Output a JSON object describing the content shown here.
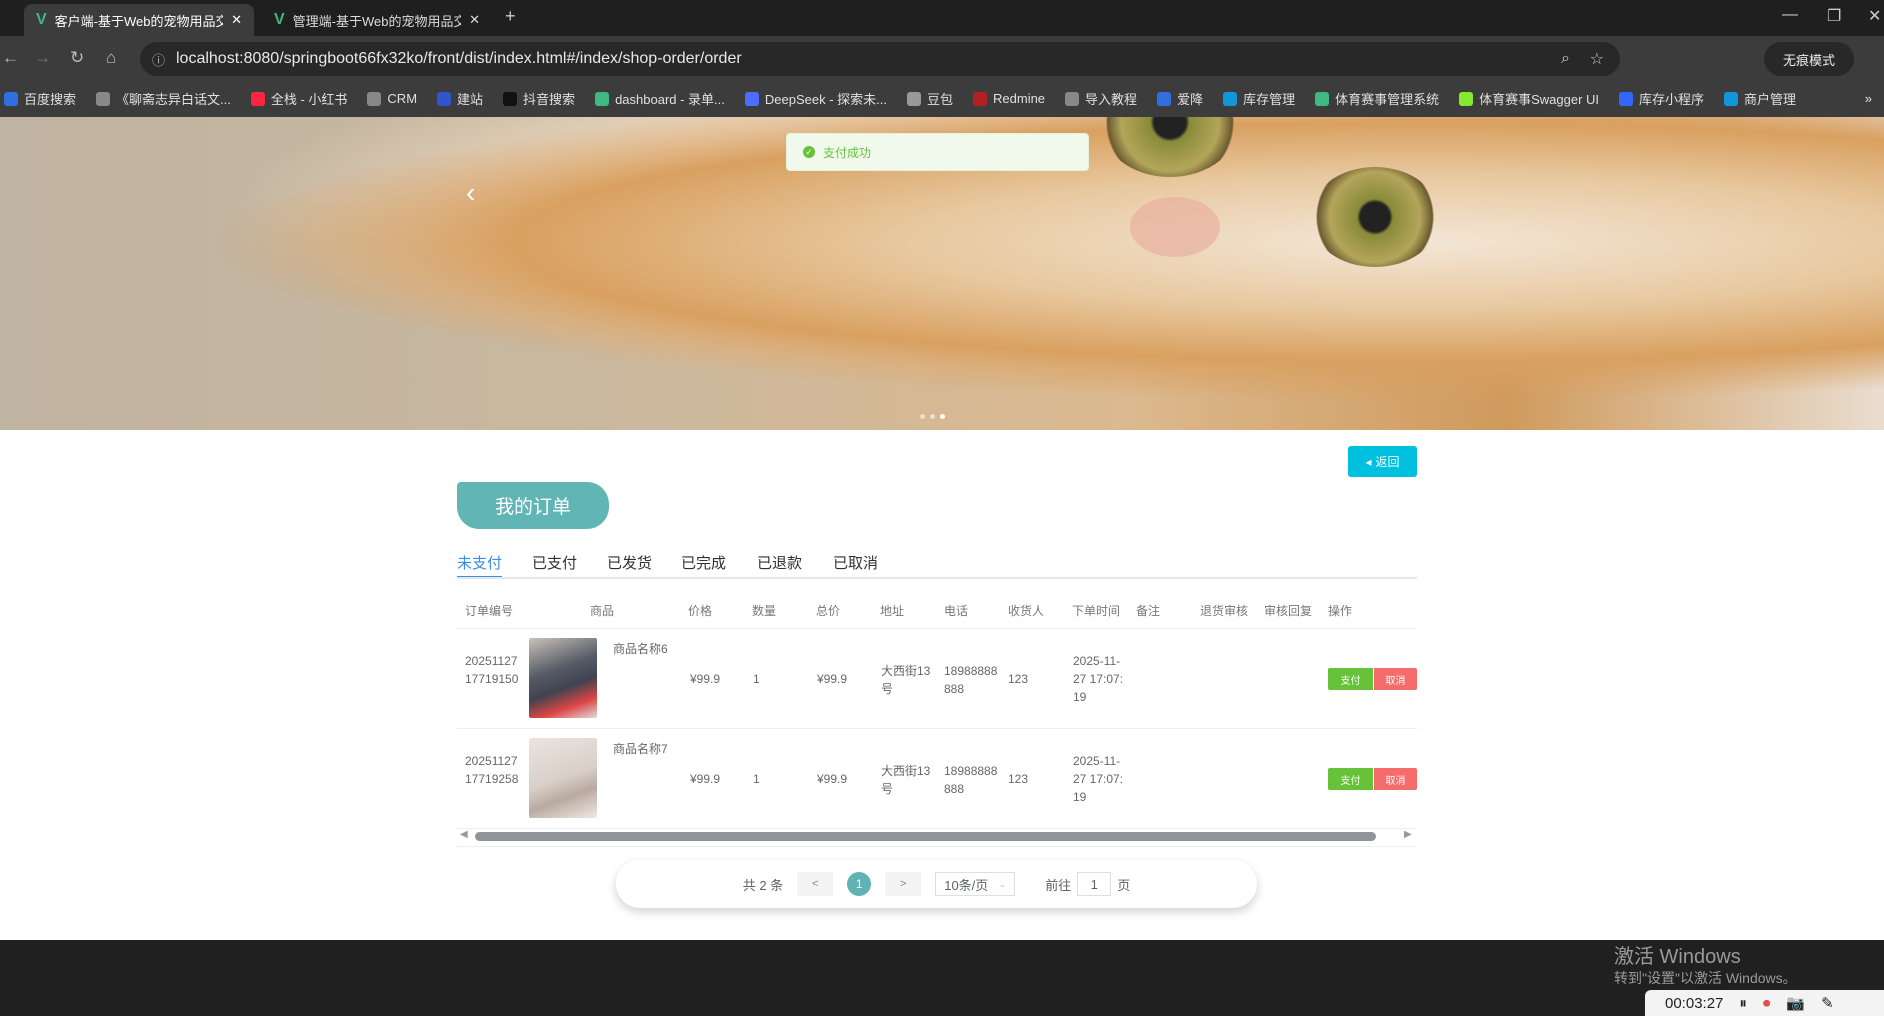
{
  "browser": {
    "tabs": [
      {
        "title": "客户端-基于Web的宠物用品交易",
        "active": true
      },
      {
        "title": "管理端-基于Web的宠物用品交易",
        "active": false
      }
    ],
    "url": "localhost:8080/springboot66fx32ko/front/dist/index.html#/index/shop-order/order",
    "incognito_label": "无痕模式",
    "bookmarks": [
      {
        "label": "百度搜索",
        "color": "#2f6fe0"
      },
      {
        "label": "《聊斋志异白话文...",
        "color": "#888888"
      },
      {
        "label": "全栈 - 小红书",
        "color": "#ff2442"
      },
      {
        "label": "CRM",
        "color": "#888888"
      },
      {
        "label": "建站",
        "color": "#3355cc"
      },
      {
        "label": "抖音搜索",
        "color": "#111111"
      },
      {
        "label": "dashboard - 录单...",
        "color": "#41b883"
      },
      {
        "label": "DeepSeek - 探索未...",
        "color": "#4d6bfe"
      },
      {
        "label": "豆包",
        "color": "#999999"
      },
      {
        "label": "Redmine",
        "color": "#b32024"
      },
      {
        "label": "导入教程",
        "color": "#888888"
      },
      {
        "label": "爱降",
        "color": "#2f6fe0"
      },
      {
        "label": "库存管理",
        "color": "#1296db"
      },
      {
        "label": "体育赛事管理系统",
        "color": "#41b883"
      },
      {
        "label": "体育赛事Swagger UI",
        "color": "#85ea2d"
      },
      {
        "label": "库存小程序",
        "color": "#3366ff"
      },
      {
        "label": "商户管理",
        "color": "#1296db"
      }
    ]
  },
  "toast": {
    "message": "支付成功",
    "type": "success"
  },
  "page": {
    "return_label": "返回",
    "title": "我的订单",
    "tabs": [
      {
        "label": "未支付",
        "active": true
      },
      {
        "label": "已支付"
      },
      {
        "label": "已发货"
      },
      {
        "label": "已完成"
      },
      {
        "label": "已退款"
      },
      {
        "label": "已取消"
      }
    ],
    "columns": [
      "订单编号",
      "商品",
      "价格",
      "数量",
      "总价",
      "地址",
      "电话",
      "收货人",
      "下单时间",
      "备注",
      "退货审核",
      "审核回复",
      "操作"
    ],
    "rows": [
      {
        "order_no": "2025112717719150",
        "product": "商品名称6",
        "price": "¥99.9",
        "qty": "1",
        "total": "¥99.9",
        "address": "大西街13号",
        "phone": "18988888888",
        "receiver": "123",
        "time": "2025-11-27 17:07:19",
        "note": "",
        "return_review": "",
        "review_reply": "",
        "pay": "支付",
        "cancel": "取消"
      },
      {
        "order_no": "2025112717719258",
        "product": "商品名称7",
        "price": "¥99.9",
        "qty": "1",
        "total": "¥99.9",
        "address": "大西街13号",
        "phone": "18988888888",
        "receiver": "123",
        "time": "2025-11-27 17:07:19",
        "note": "",
        "return_review": "",
        "review_reply": "",
        "pay": "支付",
        "cancel": "取消"
      }
    ],
    "pagination": {
      "total": "共 2 条",
      "prev": "<",
      "current": "1",
      "next": ">",
      "page_size": "10条/页",
      "goto_label": "前往",
      "goto_value": "1",
      "page_unit": "页"
    }
  },
  "os": {
    "watermark_title": "激活 Windows",
    "watermark_sub": "转到\"设置\"以激活 Windows。",
    "recorder_time": "00:03:27"
  },
  "colors": {
    "accent": "#62b5b5",
    "return": "#00c0e0",
    "pay": "#67c23a",
    "cancel": "#f56c6c",
    "tab_active": "#3a8ee6"
  }
}
